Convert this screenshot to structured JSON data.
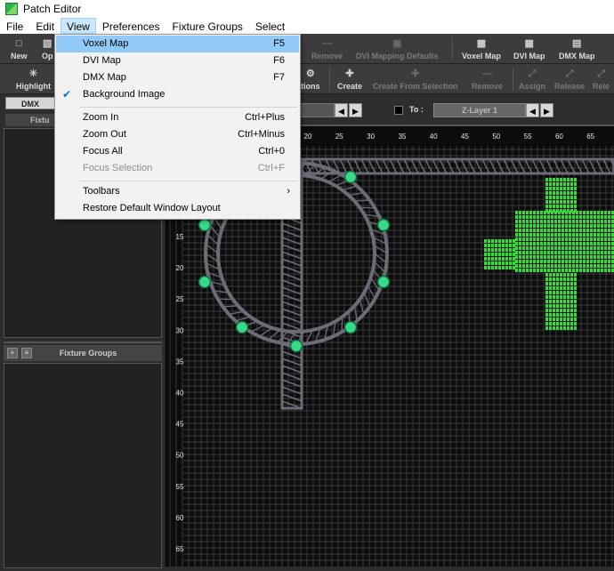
{
  "window": {
    "title": "Patch Editor"
  },
  "menu": [
    "File",
    "Edit",
    "View",
    "Preferences",
    "Fixture Groups",
    "Select"
  ],
  "toolbar1": {
    "buttons": [
      {
        "label": "New",
        "icon": "new-file-icon",
        "enabled": true
      },
      {
        "label": "Op",
        "icon": "open-folder-icon",
        "enabled": true
      },
      {
        "label": "Remove",
        "icon": "remove-icon",
        "enabled": false
      },
      {
        "label": "DVI Mapping Defaults",
        "icon": "dvi-defaults-icon",
        "enabled": false
      },
      {
        "label": "Voxel Map",
        "icon": "voxel-map-icon",
        "enabled": true
      },
      {
        "label": "DVI Map",
        "icon": "dvi-map-icon",
        "enabled": true
      },
      {
        "label": "DMX Map",
        "icon": "dmx-map-icon",
        "enabled": true
      }
    ]
  },
  "toolbar2": {
    "buttons": [
      {
        "label": "Highlight",
        "icon": "highlight-icon",
        "enabled": true
      },
      {
        "label": "tions",
        "icon": "gear-icon",
        "enabled": true
      },
      {
        "label": "Create",
        "icon": "create-icon",
        "enabled": true
      },
      {
        "label": "Create From Selection",
        "icon": "create-selection-icon",
        "enabled": false
      },
      {
        "label": "Remove",
        "icon": "remove-icon",
        "enabled": false
      },
      {
        "label": "Assign",
        "icon": "assign-icon",
        "enabled": false
      },
      {
        "label": "Release",
        "icon": "release-icon",
        "enabled": false
      },
      {
        "label": "Rele",
        "icon": "release-icon",
        "enabled": false
      }
    ]
  },
  "left_panel": {
    "dmx_tab": "DMX",
    "fixture_header": "Fixtu",
    "fixture_groups_title": "Fixture Groups"
  },
  "layer_selector": {
    "to_label": "To :",
    "to_layer": "Z-Layer 1"
  },
  "voxel_map": {
    "x_ticks": [
      "20",
      "25",
      "30",
      "35",
      "40",
      "45",
      "50",
      "55",
      "60",
      "65"
    ],
    "y_ticks": [
      "15",
      "20",
      "25",
      "30",
      "35",
      "40",
      "45",
      "50",
      "55",
      "60",
      "65"
    ],
    "fixture_color": "#39d98a",
    "pixel_color": "#2ee12e",
    "truss_color": "#6c6c78",
    "grid_color": "#3a3a3a"
  },
  "view_menu": {
    "items": [
      {
        "label": "Voxel Map",
        "shortcut": "F5",
        "highlighted": true,
        "enabled": true,
        "checked": false
      },
      {
        "label": "DVI Map",
        "shortcut": "F6",
        "highlighted": false,
        "enabled": true,
        "checked": false
      },
      {
        "label": "DMX Map",
        "shortcut": "F7",
        "highlighted": false,
        "enabled": true,
        "checked": false
      },
      {
        "label": "Background Image",
        "shortcut": "",
        "highlighted": false,
        "enabled": true,
        "checked": true
      },
      {
        "label": "Zoom In",
        "shortcut": "Ctrl+Plus",
        "highlighted": false,
        "enabled": true,
        "checked": false
      },
      {
        "label": "Zoom Out",
        "shortcut": "Ctrl+Minus",
        "highlighted": false,
        "enabled": true,
        "checked": false
      },
      {
        "label": "Focus All",
        "shortcut": "Ctrl+0",
        "highlighted": false,
        "enabled": true,
        "checked": false
      },
      {
        "label": "Focus Selection",
        "shortcut": "Ctrl+F",
        "highlighted": false,
        "enabled": false,
        "checked": false
      },
      {
        "label": "Toolbars",
        "shortcut": "",
        "highlighted": false,
        "enabled": true,
        "checked": false,
        "submenu": true
      },
      {
        "label": "Restore Default Window Layout",
        "shortcut": "",
        "highlighted": false,
        "enabled": true,
        "checked": false
      }
    ]
  }
}
